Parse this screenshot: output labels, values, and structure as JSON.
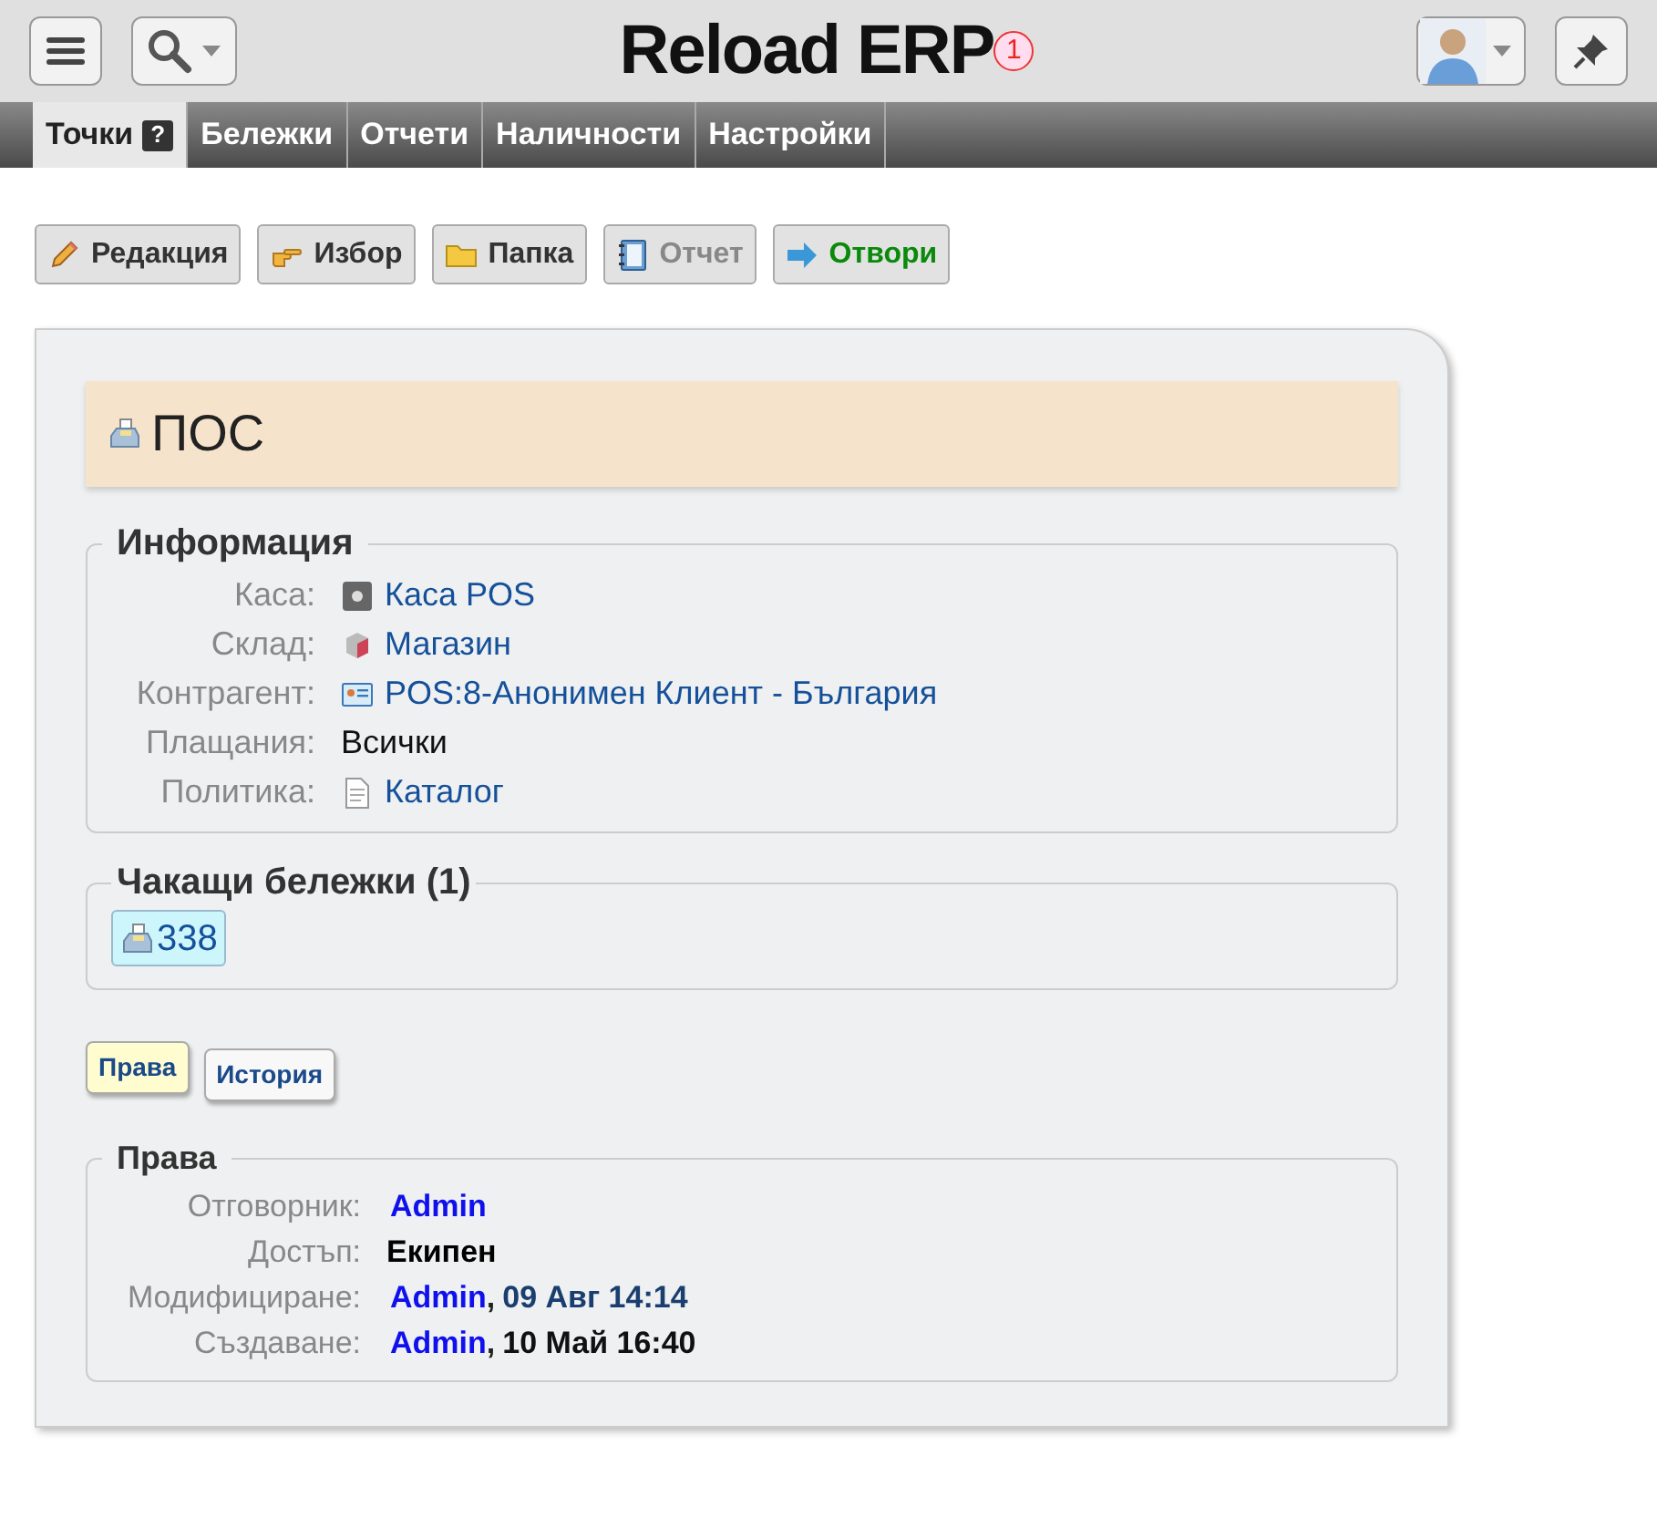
{
  "header": {
    "title": "Reload ERP",
    "notification_count": "1"
  },
  "tabs": [
    {
      "label": "Точки",
      "selected": true,
      "help": "?"
    },
    {
      "label": "Бележки",
      "selected": false
    },
    {
      "label": "Отчети",
      "selected": false
    },
    {
      "label": "Наличности",
      "selected": false
    },
    {
      "label": "Настройки",
      "selected": false
    }
  ],
  "toolbar": [
    {
      "label": "Редакция",
      "kind": "pencil",
      "disabled": false
    },
    {
      "label": "Избор",
      "kind": "hand",
      "disabled": false
    },
    {
      "label": "Папка",
      "kind": "folder",
      "disabled": false
    },
    {
      "label": "Отчет",
      "kind": "notebook",
      "disabled": true
    },
    {
      "label": "Отвори",
      "kind": "arrow",
      "disabled": false
    }
  ],
  "record": {
    "title": "ПОС",
    "info": {
      "legend": "Информация",
      "rows": [
        {
          "label": "Каса:",
          "value": "Каса POS",
          "kind": "safe",
          "link": true
        },
        {
          "label": "Склад:",
          "value": "Магазин",
          "kind": "box",
          "link": true
        },
        {
          "label": "Контрагент:",
          "value": "POS:8-Анонимен Клиент - България",
          "kind": "card",
          "link": true
        },
        {
          "label": "Плащания:",
          "value": "Всички",
          "link": false
        },
        {
          "label": "Политика:",
          "value": "Каталог",
          "kind": "doc",
          "link": true
        }
      ]
    },
    "pending": {
      "legend": "Чакащи бележки (1)",
      "items": [
        {
          "label": "338"
        }
      ]
    },
    "subtabs": [
      {
        "label": "Права",
        "selected": true
      },
      {
        "label": "История",
        "selected": false
      }
    ],
    "rights": {
      "legend": "Права",
      "rows": [
        {
          "label": "Отговорник:",
          "user": "Admin"
        },
        {
          "label": "Достъп:",
          "value": "Екипен"
        },
        {
          "label": "Модифициране:",
          "user": "Admin",
          "separator": ",",
          "date": "09 Авг 14:14",
          "recent": true
        },
        {
          "label": "Създаване:",
          "user": "Admin",
          "separator": ",",
          "date": "10 Май 16:40",
          "recent": false
        }
      ]
    }
  }
}
